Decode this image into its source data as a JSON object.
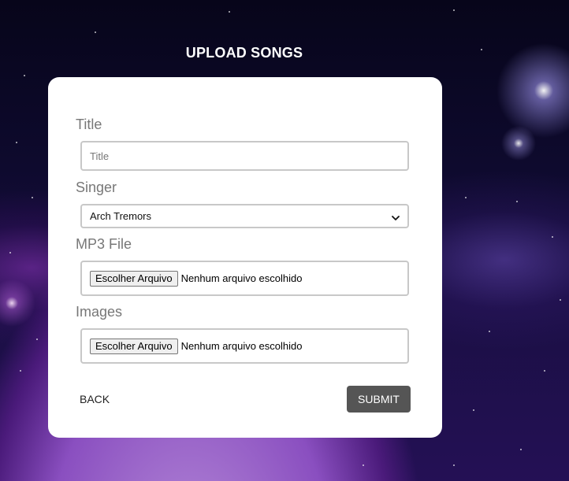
{
  "page": {
    "title": "UPLOAD SONGS"
  },
  "form": {
    "title_label": "Title",
    "title_placeholder": "Title",
    "title_value": "",
    "singer_label": "Singer",
    "singer_selected": "Arch Tremors",
    "mp3_label": "MP3 File",
    "mp3_button": "Escolher Arquivo",
    "mp3_status": "Nenhum arquivo escolhido",
    "images_label": "Images",
    "images_button": "Escolher Arquivo",
    "images_status": "Nenhum arquivo escolhido"
  },
  "actions": {
    "back_label": "BACK",
    "submit_label": "SUBMIT"
  },
  "icons": {
    "select_caret": "chevron-down-icon"
  },
  "colors": {
    "card_background": "#ffffff",
    "submit_background": "#555555",
    "label_text": "#777777",
    "input_border": "#c8c8c8"
  }
}
